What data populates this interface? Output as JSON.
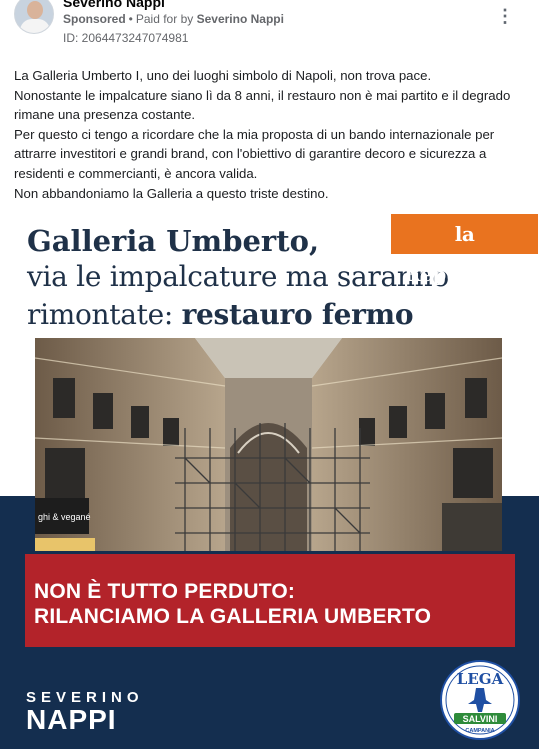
{
  "post": {
    "author": "Severino Nappi",
    "sponsored": "Sponsored",
    "separator": "•",
    "paid_for_prefix": "Paid for by",
    "paid_for_by": "Severino Nappi",
    "ad_id": "ID: 2064473247074981",
    "more_icon": "more-options-icon",
    "paragraphs": [
      "La Galleria Umberto I, uno dei luoghi simbolo di Napoli, non trova pace.",
      "Nonostante le impalcature siano lì da 8 anni, il restauro non è mai partito e il degrado rimane una presenza costante.",
      "Per questo ci tengo a ricordare che la mia proposta di un bando internazionale per attrarre investitori e grandi brand, con l'obiettivo di garantire decoro e sicurezza a residenti e commercianti, è ancora valida.",
      "Non abbandoniamo la Galleria a questo triste destino."
    ]
  },
  "creative": {
    "headline_line1": "Galleria Umberto,",
    "headline_line2": "via le impalcature ma saranno",
    "headline_line3_regular": "rimontate: ",
    "headline_line3_bold": "restauro fermo",
    "newspaper": "la Repubblica",
    "banner_line1": "NON È TUTTO PERDUTO:",
    "banner_line2": "RILANCIAMO LA GALLERIA UMBERTO",
    "brand_first": "SEVERINO",
    "brand_last": "NAPPI",
    "photo_sign": "ghi & vegané",
    "logo": {
      "top": "LEGA",
      "band": "SALVINI",
      "bottom": "CAMPANIA"
    },
    "colors": {
      "navy": "#142e4f",
      "headline": "#1f3148",
      "red": "#b3232a",
      "repubblica": "#e9731f",
      "lega_blue": "#1f4fa3",
      "lega_green": "#2e8b3a"
    }
  }
}
